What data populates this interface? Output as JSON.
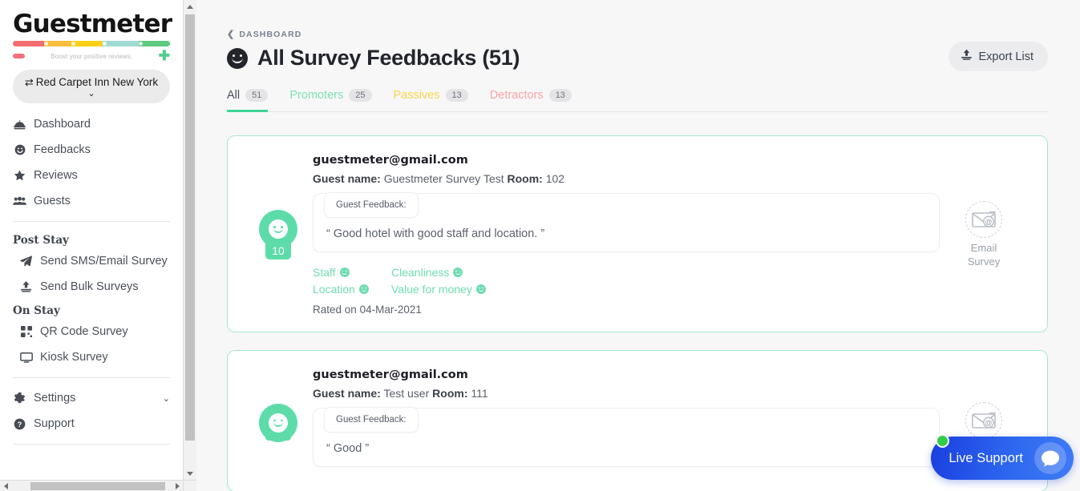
{
  "sidebar": {
    "logo_text": "Guestmeter",
    "tagline": "Boost your positive reviews.",
    "property": {
      "name": "Red Carpet Inn New York",
      "swap_icon": "⇄",
      "caret_icon": "⌄"
    },
    "nav": [
      {
        "label": "Dashboard",
        "icon": "dashboard-bell-icon"
      },
      {
        "label": "Feedbacks",
        "icon": "smiley-icon"
      },
      {
        "label": "Reviews",
        "icon": "star-icon"
      },
      {
        "label": "Guests",
        "icon": "users-icon"
      }
    ],
    "group_post_stay": "Post Stay",
    "post_stay": [
      {
        "label": "Send SMS/Email Survey",
        "icon": "paper-plane-icon"
      },
      {
        "label": "Send Bulk Surveys",
        "icon": "upload-icon"
      }
    ],
    "group_on_stay": "On Stay",
    "on_stay": [
      {
        "label": "QR Code Survey",
        "icon": "qr-code-icon"
      },
      {
        "label": "Kiosk Survey",
        "icon": "monitor-icon"
      }
    ],
    "footer": [
      {
        "label": "Settings",
        "icon": "gear-icon",
        "chevron": "⌄"
      },
      {
        "label": "Support",
        "icon": "question-circle-icon"
      }
    ]
  },
  "header": {
    "breadcrumb": "DASHBOARD",
    "breadcrumb_icon": "chevron-left-icon",
    "title": "All Survey Feedbacks (51)",
    "title_icon": "smiley-icon",
    "export_label": "Export List",
    "export_icon": "download-icon"
  },
  "tabs": [
    {
      "label": "All",
      "count": "51",
      "active": true,
      "color": "#4a4f58"
    },
    {
      "label": "Promoters",
      "count": "25",
      "active": false,
      "color": "#7ee0b4"
    },
    {
      "label": "Passives",
      "count": "13",
      "active": false,
      "color": "#fcd34d"
    },
    {
      "label": "Detractors",
      "count": "13",
      "active": false,
      "color": "#fca5a5"
    }
  ],
  "tab_indicator_color": "#3fd398",
  "feedback_label": "Guest Feedback:",
  "guest_name_label": "Guest name:",
  "room_label": "Room:",
  "rated_prefix": "Rated on",
  "cards": [
    {
      "email": "guestmeter@gmail.com",
      "guest_name": "Guestmeter Survey Test",
      "room": "102",
      "score": "10",
      "feedback": "“ Good hotel with good staff and location. ”",
      "categories": [
        "Staff",
        "Cleanliness",
        "Location",
        "Value for money"
      ],
      "rated_on": "04-Mar-2021",
      "channel": {
        "line1": "Email",
        "line2": "Survey",
        "icon": "email-at-envelope-icon"
      }
    },
    {
      "email": "guestmeter@gmail.com",
      "guest_name": "Test user",
      "room": "111",
      "score": "",
      "feedback": "“ Good ”",
      "categories": [],
      "rated_on": "",
      "channel": {
        "line1": "",
        "line2": "",
        "icon": "email-at-envelope-icon"
      }
    }
  ],
  "live_support": {
    "label": "Live Support",
    "icon": "chat-bubble-icon",
    "status_dot_color": "#33cc4a"
  }
}
